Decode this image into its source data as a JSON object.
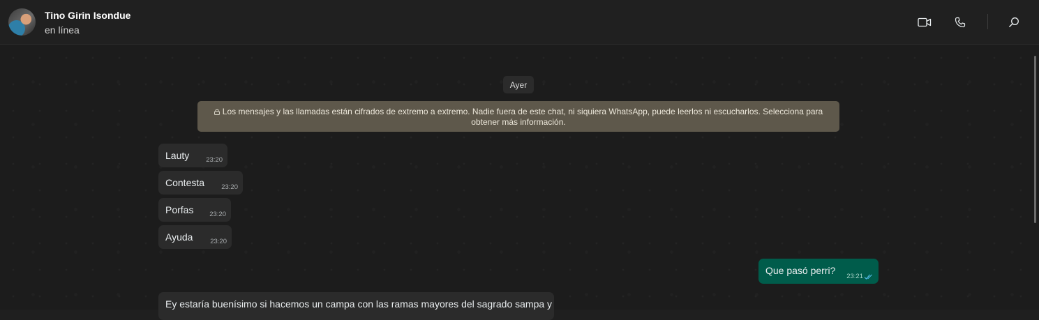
{
  "header": {
    "contact_name": "Tino Girin Isondue",
    "status": "en línea",
    "icons": [
      "video-call-icon",
      "voice-call-icon",
      "search-icon"
    ]
  },
  "chat": {
    "day_label": "Ayer",
    "encryption_notice": "Los mensajes y las llamadas están cifrados de extremo a extremo. Nadie fuera de este chat, ni siquiera WhatsApp, puede leerlos ni escucharlos. Selecciona para obtener más información.",
    "messages": [
      {
        "direction": "in",
        "text": "Lauty",
        "time": "23:20"
      },
      {
        "direction": "in",
        "text": "Contesta",
        "time": "23:20"
      },
      {
        "direction": "in",
        "text": "Porfas",
        "time": "23:20"
      },
      {
        "direction": "in",
        "text": "Ayuda",
        "time": "23:20"
      },
      {
        "direction": "out",
        "text": "Que pasó perri?",
        "time": "23:21",
        "status": "read"
      },
      {
        "direction": "in",
        "text": "Ey estaría buenísimo si hacemos un campa con las ramas mayores del sagrado sampa y",
        "time": ""
      }
    ]
  },
  "colors": {
    "incoming_bubble": "#2b2b2b",
    "outgoing_bubble": "#005c4b",
    "notice_bg": "#5e584b",
    "read_tick": "#53bdeb"
  }
}
